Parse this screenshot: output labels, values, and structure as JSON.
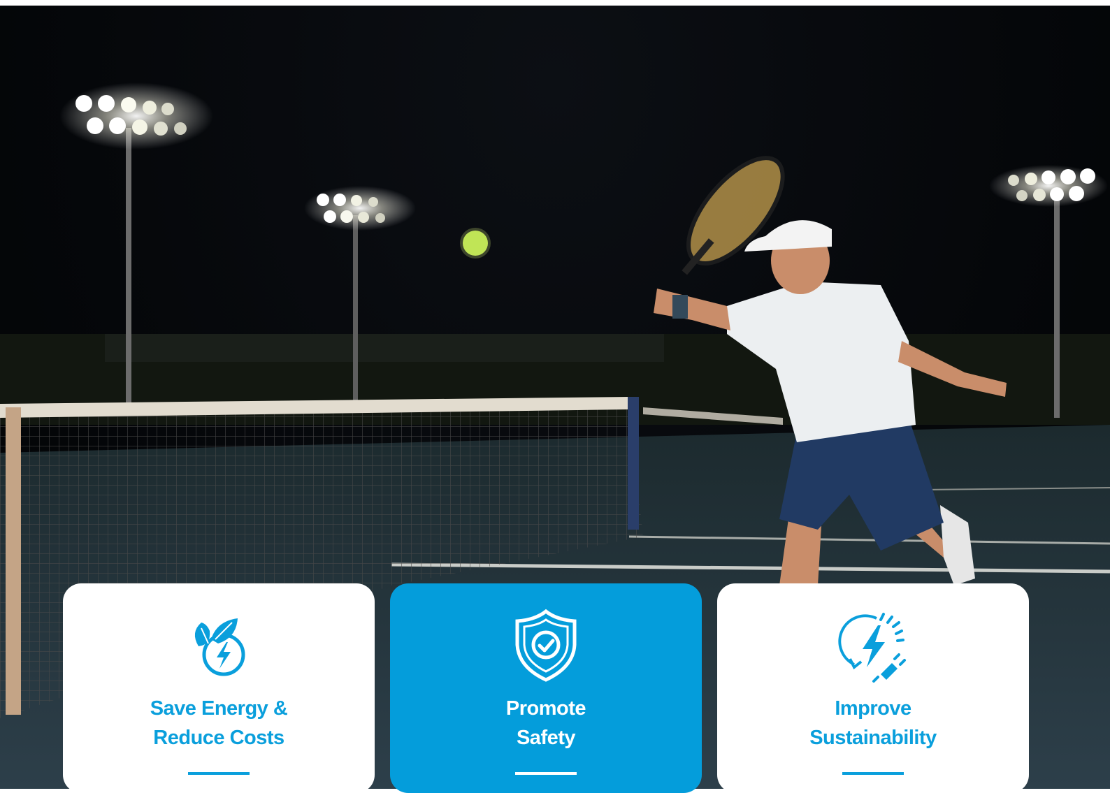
{
  "hero": {
    "image": "night tennis court with floodlights and player hitting ball"
  },
  "cards": [
    {
      "title_line1": "Save Energy &",
      "title_line2": "Reduce Costs",
      "icon": "leaf-lightning-icon"
    },
    {
      "title_line1": "Promote",
      "title_line2": "Safety",
      "icon": "shield-check-icon"
    },
    {
      "title_line1": "Improve",
      "title_line2": "Sustainability",
      "icon": "renewable-energy-plug-icon"
    }
  ],
  "colors": {
    "accent": "#049ddb",
    "card_bg": "#ffffff",
    "card_highlight_bg": "#049ddb"
  }
}
